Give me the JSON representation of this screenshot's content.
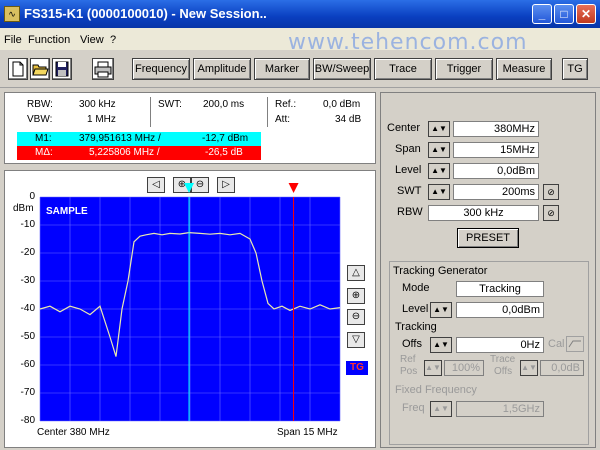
{
  "window": {
    "title": "FS315-K1 (0000100010) - New Session..",
    "app_icon_glyph": "∿",
    "minimize_glyph": "_",
    "maximize_glyph": "□",
    "close_glyph": "✕"
  },
  "watermark": "www.tehencom.com",
  "menu": [
    "File",
    "Function",
    "View",
    "?"
  ],
  "toolbar": {
    "icons": [
      "new-file-icon",
      "open-folder-icon",
      "save-disk-icon",
      "print-icon"
    ],
    "buttons": [
      "Frequency",
      "Amplitude",
      "Marker",
      "BW/Sweep",
      "Trace",
      "Trigger",
      "Measure",
      "TG"
    ]
  },
  "info": {
    "rbw_label": "RBW:",
    "rbw_value": "300 kHz",
    "vbw_label": "VBW:",
    "vbw_value": "1 MHz",
    "swt_label": "SWT:",
    "swt_value": "200,0 ms",
    "ref_label": "Ref.:",
    "ref_value": "0,0 dBm",
    "att_label": "Att:",
    "att_value": "34 dB",
    "m1_label": "M1:",
    "m1_freq": "379,951613 MHz /",
    "m1_level": "-12,7 dBm",
    "m2_label": "MΔ:",
    "m2_freq": "5,225806 MHz /",
    "m2_level": "-26,5 dB"
  },
  "plot": {
    "mode_label": "SAMPLE",
    "unit_label": "dBm",
    "y_ticks": [
      "0",
      "-10",
      "-20",
      "-30",
      "-40",
      "-50",
      "-60",
      "-70",
      "-80"
    ],
    "center_label": "Center 380 MHz",
    "span_label": "Span 15 MHz",
    "tg_label": "TG",
    "nav": {
      "left": "◁",
      "zoom_in": "⊕",
      "zoom_out": "⊖",
      "right": "▷"
    },
    "side": {
      "up": "△",
      "zoom_in": "⊕",
      "zoom_out": "⊖",
      "down": "▽"
    }
  },
  "chart_data": {
    "type": "line",
    "ylim": [
      -80,
      0
    ],
    "xlim": [
      372.5,
      387.5
    ],
    "x": [
      372.5,
      373.0,
      373.5,
      374.0,
      374.5,
      375.0,
      375.5,
      376.0,
      376.3,
      376.6,
      376.9,
      377.2,
      377.5,
      377.8,
      378.2,
      378.6,
      379.0,
      379.5,
      379.95,
      380.5,
      381.0,
      381.5,
      382.0,
      382.5,
      383.0,
      383.3,
      383.6,
      383.9,
      384.2,
      384.6,
      385.0,
      385.5,
      386.0,
      386.5,
      387.0,
      387.5
    ],
    "series": [
      {
        "values": [
          -40,
          -39,
          -41,
          -39,
          -40,
          -42,
          -39,
          -50,
          -57,
          -40,
          -30,
          -16,
          -14,
          -13.5,
          -13,
          -13.5,
          -13,
          -13.2,
          -12.7,
          -13,
          -13.3,
          -13,
          -13.5,
          -13,
          -15,
          -20,
          -30,
          -38,
          -40,
          -39,
          -40.5,
          -39,
          -40,
          -38.5,
          -40,
          -39.5
        ]
      }
    ],
    "markers": [
      {
        "name": "M1",
        "x": 379.951613,
        "y": -12.7
      },
      {
        "name": "MΔ",
        "x": 385.177419,
        "y": -39.2
      }
    ],
    "colors": {
      "background": "#0000ff",
      "grid": "#6a6aff",
      "trace": "#e8e8b0",
      "marker1": "#00ffff",
      "marker2": "#ff0000"
    }
  },
  "params": {
    "center_label": "Center",
    "center_value": "380MHz",
    "span_label": "Span",
    "span_value": "15MHz",
    "level_label": "Level",
    "level_value": "0,0dBm",
    "swt_label": "SWT",
    "swt_value": "200ms",
    "rbw_label": "RBW",
    "rbw_value": "300 kHz",
    "spin_glyph": "▲▼",
    "link_glyph": "⊘",
    "preset_label": "PRESET"
  },
  "tracking": {
    "title": "Tracking Generator",
    "mode_label": "Mode",
    "mode_value": "Tracking",
    "level_label": "Level",
    "level_value": "0,0dBm",
    "tracking_label": "Tracking",
    "offs_label": "Offs",
    "offs_value": "0Hz",
    "cal_label": "Cal",
    "ref_pos_label1": "Ref",
    "ref_pos_label2": "Pos",
    "ref_pos_value": "100%",
    "trace_offs_label1": "Trace",
    "trace_offs_label2": "Offs",
    "trace_offs_value": "0,0dB",
    "fixed_freq_title": "Fixed Frequency",
    "freq_label": "Freq",
    "freq_value": "1,5GHz"
  }
}
